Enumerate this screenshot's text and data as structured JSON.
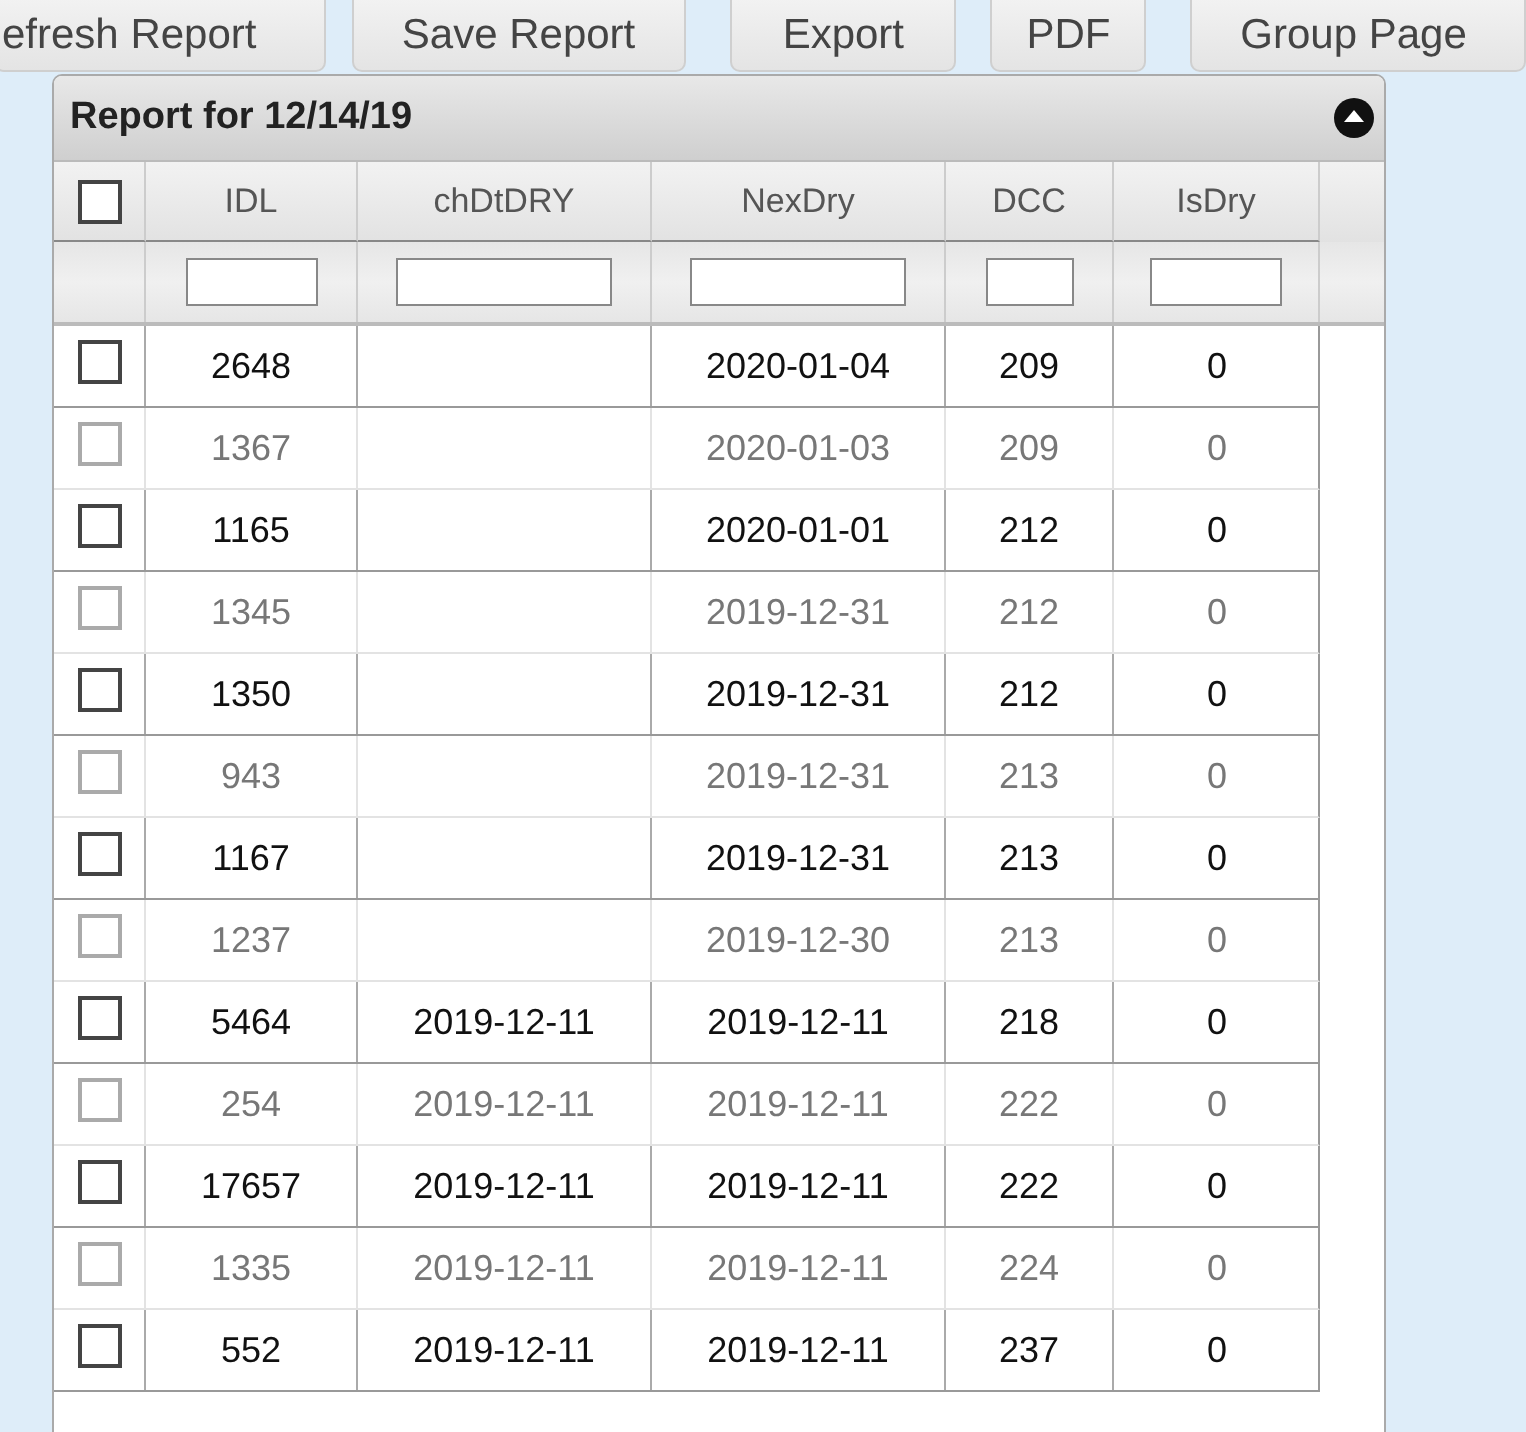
{
  "toolbar": [
    "efresh Report",
    "Save Report",
    "Export",
    "PDF",
    "Group Page"
  ],
  "panel": {
    "title": "Report for 12/14/19",
    "expanded": true
  },
  "table": {
    "select_all": {
      "checked": false
    },
    "columns": [
      "IDL",
      "chDtDRY",
      "NexDry",
      "DCC",
      "IsDry"
    ],
    "rows": [
      {
        "checked": false,
        "dimmed": false,
        "cells": [
          "2648",
          "",
          "2020-01-04",
          "209",
          "0"
        ]
      },
      {
        "checked": false,
        "dimmed": true,
        "cells": [
          "1367",
          "",
          "2020-01-03",
          "209",
          "0"
        ]
      },
      {
        "checked": false,
        "dimmed": false,
        "cells": [
          "1165",
          "",
          "2020-01-01",
          "212",
          "0"
        ]
      },
      {
        "checked": false,
        "dimmed": true,
        "cells": [
          "1345",
          "",
          "2019-12-31",
          "212",
          "0"
        ]
      },
      {
        "checked": false,
        "dimmed": false,
        "cells": [
          "1350",
          "",
          "2019-12-31",
          "212",
          "0"
        ]
      },
      {
        "checked": false,
        "dimmed": true,
        "cells": [
          "943",
          "",
          "2019-12-31",
          "213",
          "0"
        ]
      },
      {
        "checked": false,
        "dimmed": false,
        "cells": [
          "1167",
          "",
          "2019-12-31",
          "213",
          "0"
        ]
      },
      {
        "checked": false,
        "dimmed": true,
        "cells": [
          "1237",
          "",
          "2019-12-30",
          "213",
          "0"
        ]
      },
      {
        "checked": false,
        "dimmed": false,
        "cells": [
          "5464",
          "2019-12-11",
          "2019-12-11",
          "218",
          "0"
        ]
      },
      {
        "checked": false,
        "dimmed": true,
        "cells": [
          "254",
          "2019-12-11",
          "2019-12-11",
          "222",
          "0"
        ]
      },
      {
        "checked": false,
        "dimmed": false,
        "cells": [
          "17657",
          "2019-12-11",
          "2019-12-11",
          "222",
          "0"
        ]
      },
      {
        "checked": false,
        "dimmed": true,
        "cells": [
          "1335",
          "2019-12-11",
          "2019-12-11",
          "224",
          "0"
        ]
      },
      {
        "checked": false,
        "dimmed": false,
        "cells": [
          "552",
          "2019-12-11",
          "2019-12-11",
          "237",
          "0"
        ]
      }
    ]
  }
}
